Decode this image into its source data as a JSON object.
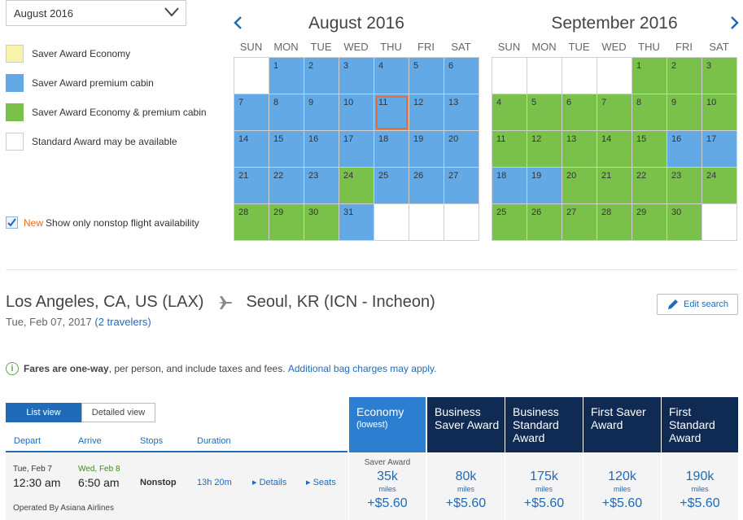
{
  "month_select": {
    "value": "August 2016"
  },
  "legend": [
    {
      "label": "Saver Award Economy",
      "color": "#f7f4a8"
    },
    {
      "label": "Saver Award premium cabin",
      "color": "#63a9e6"
    },
    {
      "label": "Saver Award Economy & premium cabin",
      "color": "#79c14a"
    },
    {
      "label": "Standard Award may be available",
      "color": "#ffffff"
    }
  ],
  "nonstop": {
    "new_tag": "New",
    "label": "Show only nonstop flight availability",
    "checked": true
  },
  "calendars": [
    {
      "title": "August 2016",
      "days_of_week": [
        "SUN",
        "MON",
        "TUE",
        "WED",
        "THU",
        "FRI",
        "SAT"
      ],
      "lead_blank": 1,
      "days": [
        {
          "d": "1",
          "c": "blue"
        },
        {
          "d": "2",
          "c": "blue"
        },
        {
          "d": "3",
          "c": "blue"
        },
        {
          "d": "4",
          "c": "blue"
        },
        {
          "d": "5",
          "c": "blue"
        },
        {
          "d": "6",
          "c": "blue"
        },
        {
          "d": "7",
          "c": "blue"
        },
        {
          "d": "8",
          "c": "blue"
        },
        {
          "d": "9",
          "c": "blue"
        },
        {
          "d": "10",
          "c": "blue"
        },
        {
          "d": "11",
          "c": "blue",
          "selected": true
        },
        {
          "d": "12",
          "c": "blue"
        },
        {
          "d": "13",
          "c": "blue"
        },
        {
          "d": "14",
          "c": "blue"
        },
        {
          "d": "15",
          "c": "blue"
        },
        {
          "d": "16",
          "c": "blue"
        },
        {
          "d": "17",
          "c": "blue"
        },
        {
          "d": "18",
          "c": "blue"
        },
        {
          "d": "19",
          "c": "blue"
        },
        {
          "d": "20",
          "c": "blue"
        },
        {
          "d": "21",
          "c": "blue"
        },
        {
          "d": "22",
          "c": "blue"
        },
        {
          "d": "23",
          "c": "blue"
        },
        {
          "d": "24",
          "c": "green"
        },
        {
          "d": "25",
          "c": "blue"
        },
        {
          "d": "26",
          "c": "blue"
        },
        {
          "d": "27",
          "c": "blue"
        },
        {
          "d": "28",
          "c": "green"
        },
        {
          "d": "29",
          "c": "green"
        },
        {
          "d": "30",
          "c": "green"
        },
        {
          "d": "31",
          "c": "blue"
        }
      ],
      "trail_blank": 3
    },
    {
      "title": "September 2016",
      "days_of_week": [
        "SUN",
        "MON",
        "TUE",
        "WED",
        "THU",
        "FRI",
        "SAT"
      ],
      "lead_blank": 4,
      "days": [
        {
          "d": "1",
          "c": "green"
        },
        {
          "d": "2",
          "c": "green"
        },
        {
          "d": "3",
          "c": "green"
        },
        {
          "d": "4",
          "c": "green"
        },
        {
          "d": "5",
          "c": "green"
        },
        {
          "d": "6",
          "c": "green"
        },
        {
          "d": "7",
          "c": "green"
        },
        {
          "d": "8",
          "c": "green"
        },
        {
          "d": "9",
          "c": "green"
        },
        {
          "d": "10",
          "c": "green"
        },
        {
          "d": "11",
          "c": "green"
        },
        {
          "d": "12",
          "c": "green"
        },
        {
          "d": "13",
          "c": "green"
        },
        {
          "d": "14",
          "c": "green"
        },
        {
          "d": "15",
          "c": "green"
        },
        {
          "d": "16",
          "c": "blue"
        },
        {
          "d": "17",
          "c": "blue"
        },
        {
          "d": "18",
          "c": "blue"
        },
        {
          "d": "19",
          "c": "blue"
        },
        {
          "d": "20",
          "c": "green"
        },
        {
          "d": "21",
          "c": "green"
        },
        {
          "d": "22",
          "c": "green"
        },
        {
          "d": "23",
          "c": "green"
        },
        {
          "d": "24",
          "c": "green"
        },
        {
          "d": "25",
          "c": "green"
        },
        {
          "d": "26",
          "c": "green"
        },
        {
          "d": "27",
          "c": "green"
        },
        {
          "d": "28",
          "c": "green"
        },
        {
          "d": "29",
          "c": "green"
        },
        {
          "d": "30",
          "c": "green"
        }
      ],
      "trail_blank": 1
    }
  ],
  "route": {
    "origin": "Los Angeles, CA, US (LAX)",
    "destination": "Seoul, KR (ICN - Incheon)",
    "date": "Tue, Feb 07, 2017",
    "travelers": "(2 travelers)"
  },
  "edit_search": "Edit search",
  "fare_note": {
    "bold": "Fares are one-way",
    "rest": ", per person, and include taxes and fees.",
    "link": "Additional bag charges may apply."
  },
  "views": {
    "list": "List view",
    "detailed": "Detailed view"
  },
  "columns": {
    "depart": "Depart",
    "arrive": "Arrive",
    "stops": "Stops",
    "duration": "Duration"
  },
  "flight": {
    "depart_date": "Tue, Feb 7",
    "depart_time": "12:30 am",
    "arrive_date": "Wed, Feb 8",
    "arrive_time": "6:50 am",
    "stops": "Nonstop",
    "duration": "13h 20m",
    "details": "Details",
    "seats": "Seats",
    "operated_by": "Operated By Asiana Airlines"
  },
  "fare_columns": [
    {
      "title": "Economy",
      "sub": "(lowest)",
      "tag": "Saver Award",
      "miles": "35k",
      "miles_label": "miles",
      "fee": "+$5.60"
    },
    {
      "title": "Business Saver Award",
      "sub": "",
      "tag": "",
      "miles": "80k",
      "miles_label": "miles",
      "fee": "+$5.60"
    },
    {
      "title": "Business Standard Award",
      "sub": "",
      "tag": "",
      "miles": "175k",
      "miles_label": "miles",
      "fee": "+$5.60"
    },
    {
      "title": "First Saver Award",
      "sub": "",
      "tag": "",
      "miles": "120k",
      "miles_label": "miles",
      "fee": "+$5.60"
    },
    {
      "title": "First Standard Award",
      "sub": "",
      "tag": "",
      "miles": "190k",
      "miles_label": "miles",
      "fee": "+$5.60"
    }
  ]
}
